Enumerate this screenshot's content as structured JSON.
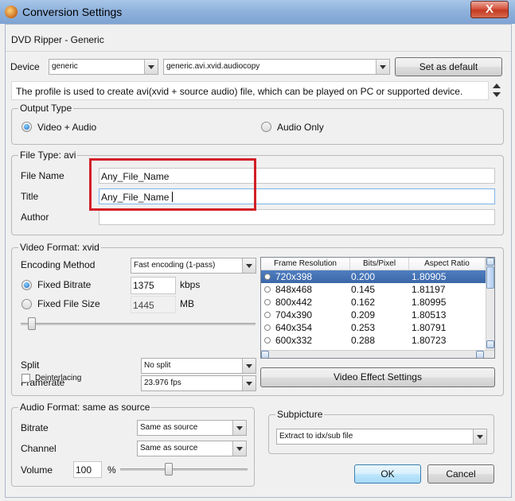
{
  "window": {
    "title": "Conversion Settings",
    "close_glyph": "X",
    "icon": "app-icon"
  },
  "profile": {
    "name": "DVD Ripper - Generic"
  },
  "device": {
    "label": "Device",
    "selected": "generic",
    "profile_selected": "generic.avi.xvid.audiocopy",
    "set_default_label": "Set as default",
    "description": "The profile is used to create avi(xvid + source audio) file, which can be played on PC or supported device."
  },
  "output_type": {
    "title": "Output Type",
    "options": [
      {
        "label": "Video + Audio",
        "checked": true
      },
      {
        "label": "Audio Only",
        "checked": false
      }
    ]
  },
  "file_type": {
    "title": "File Type: avi",
    "file_name_label": "File Name",
    "file_name_value": "Any_File_Name",
    "title_label": "Title",
    "title_value": "Any_File_Name",
    "author_label": "Author",
    "author_value": ""
  },
  "video_format": {
    "title": "Video Format: xvid",
    "encoding_label": "Encoding Method",
    "encoding_value": "Fast encoding (1-pass)",
    "fixed_bitrate_label": "Fixed Bitrate",
    "bitrate_value": "1375",
    "bitrate_unit": "kbps",
    "fixed_size_label": "Fixed File Size",
    "size_value": "1445",
    "size_unit": "MB",
    "quality_slider_value": 0.03,
    "split_label": "Split",
    "split_value": "No split",
    "framerate_label": "Framerate",
    "framerate_value": "23.976 fps",
    "deinterlacing_label": "Deinterlacing",
    "effect_button_label": "Video Effect Settings",
    "table": {
      "headers": [
        "Frame Resolution",
        "Bits/Pixel",
        "Aspect Ratio"
      ],
      "rows": [
        [
          "720x398",
          "0.200",
          "1.80905"
        ],
        [
          "848x468",
          "0.145",
          "1.81197"
        ],
        [
          "800x442",
          "0.162",
          "1.80995"
        ],
        [
          "704x390",
          "0.209",
          "1.80513"
        ],
        [
          "640x354",
          "0.253",
          "1.80791"
        ],
        [
          "600x332",
          "0.288",
          "1.80723"
        ]
      ],
      "selected_index": 0
    }
  },
  "audio_format": {
    "title": "Audio Format: same as source",
    "bitrate_label": "Bitrate",
    "bitrate_value": "Same as source",
    "channel_label": "Channel",
    "channel_value": "Same as source",
    "volume_label": "Volume",
    "volume_value": "100",
    "volume_unit": "%",
    "volume_slider_value": 0.37
  },
  "subpicture": {
    "title": "Subpicture",
    "value": "Extract to idx/sub file"
  },
  "buttons": {
    "ok": "OK",
    "cancel": "Cancel"
  },
  "colors": {
    "highlight": "#d21f26",
    "selection": "#3b67a8",
    "titlebar": "#8fb2dd",
    "close": "#c23b21"
  }
}
